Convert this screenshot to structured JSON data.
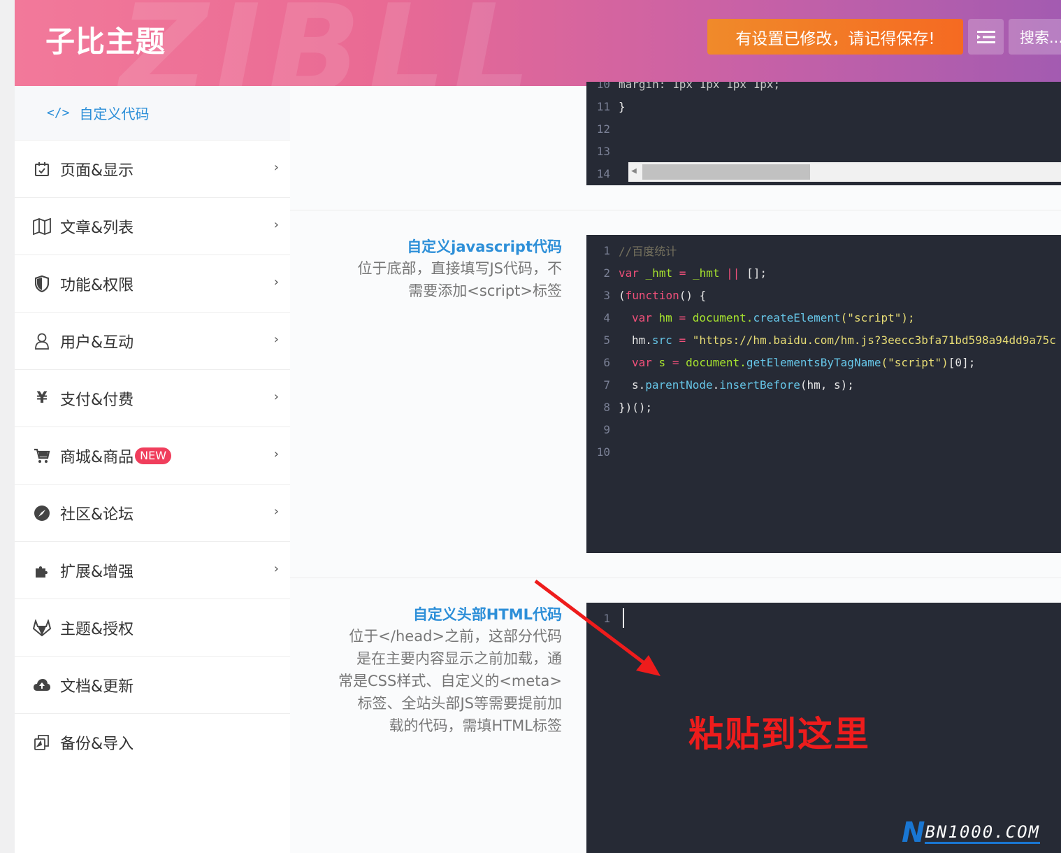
{
  "header": {
    "brand": "子比主题",
    "watermark": "ZIBLL",
    "save_notice": "有设置已修改，请记得保存!",
    "search_label": "搜索..."
  },
  "sidebar": {
    "section_title": "自定义代码",
    "items": [
      {
        "label": "页面&显示",
        "icon": "calendar-check-icon"
      },
      {
        "label": "文章&列表",
        "icon": "map-icon"
      },
      {
        "label": "功能&权限",
        "icon": "shield-icon"
      },
      {
        "label": "用户&互动",
        "icon": "user-icon"
      },
      {
        "label": "支付&付费",
        "icon": "yen-icon"
      },
      {
        "label": "商城&商品",
        "icon": "cart-icon",
        "badge": "NEW"
      },
      {
        "label": "社区&论坛",
        "icon": "compass-icon"
      },
      {
        "label": "扩展&增强",
        "icon": "puzzle-icon"
      },
      {
        "label": "主题&授权",
        "icon": "gitlab-icon"
      },
      {
        "label": "文档&更新",
        "icon": "cloud-upload-icon"
      },
      {
        "label": "备份&导入",
        "icon": "copy-icon"
      }
    ]
  },
  "css_editor": {
    "lines": [
      {
        "n": "10",
        "code": "    margin: 1px 1px 1px 1px;"
      },
      {
        "n": "11",
        "code": "}"
      },
      {
        "n": "12",
        "code": ""
      },
      {
        "n": "13",
        "code": ""
      },
      {
        "n": "14",
        "code": ""
      }
    ]
  },
  "js_setting": {
    "title": "自定义javascript代码",
    "desc_lines": [
      "位于底部，直接填写JS代码，不",
      "需要添加<script>标签"
    ]
  },
  "js_editor": {
    "line_numbers": [
      "1",
      "2",
      "3",
      "4",
      "5",
      "6",
      "7",
      "8",
      "9",
      "10"
    ],
    "code": {
      "l1": "//百度统计",
      "l2_kw": "var",
      "l2_var": "_hmt",
      "l2_eq": "=",
      "l2_var2": "_hmt",
      "l2_op": "||",
      "l2_rest": "[];",
      "l3_open": "(",
      "l3_kw": "function",
      "l3_rest": "() {",
      "l4_kw": "var",
      "l4_var": "hm",
      "l4_eq": "=",
      "l4_obj": "document.",
      "l4_fn": "createElement",
      "l4_str": "(\"script\");",
      "l5_obj": "hm.",
      "l5_fn": "src",
      "l5_eq": "=",
      "l5_str": "\"https://hm.baidu.com/hm.js?3eecc3bfa71bd598a94dd9a75c",
      "l6_kw": "var",
      "l6_var": "s",
      "l6_eq": "=",
      "l6_obj": "document.",
      "l6_fn": "getElementsByTagName",
      "l6_str": "(\"script\")",
      "l6_rest": "[0];",
      "l7_obj": "s.",
      "l7_fn": "parentNode",
      "l7_dot": ".",
      "l7_fn2": "insertBefore",
      "l7_rest": "(hm, s);",
      "l8": "})();"
    }
  },
  "html_setting": {
    "title": "自定义头部HTML代码",
    "desc_lines": [
      "位于</head>之前，这部分代码",
      "是在主要内容显示之前加载，通",
      "常是CSS样式、自定义的<meta>",
      "标签、全站头部JS等需要提前加",
      "载的代码，需填HTML标签"
    ]
  },
  "html_editor": {
    "line_numbers": [
      "1"
    ]
  },
  "annotation": "粘贴到这里",
  "logo": {
    "n": "N",
    "rest": "BN1000.COM"
  },
  "colors": {
    "accent": "#2d8fd8",
    "save": "#f56a22",
    "editor_bg": "#262a35",
    "annotation": "#ee1c1c",
    "badge": "#f03e5c"
  }
}
